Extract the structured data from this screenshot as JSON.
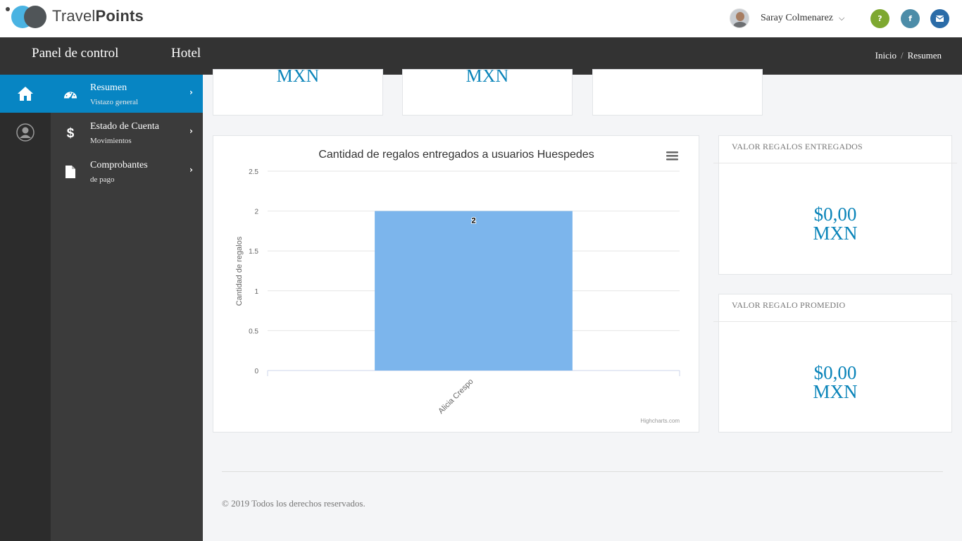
{
  "brand": {
    "light": "Travel",
    "bold": "Points"
  },
  "user": {
    "name": "Saray Colmenarez"
  },
  "topbar_buttons": {
    "help": "?",
    "facebook": "f",
    "mail": "✉"
  },
  "header": {
    "panel_label": "Panel de control",
    "section_label": "Hotel"
  },
  "breadcrumb": {
    "items": [
      "Inicio",
      "Resumen"
    ],
    "separator": "/"
  },
  "sidebar": {
    "items": [
      {
        "label": "Resumen",
        "sub": "Vistazo general",
        "active": true
      },
      {
        "label": "Estado de Cuenta",
        "sub": "Movimientos",
        "active": false
      },
      {
        "label": "Comprobantes",
        "sub": "de pago",
        "active": false
      }
    ]
  },
  "top_stats": [
    {
      "value": "MXN"
    },
    {
      "value": "MXN"
    },
    {
      "value": ""
    }
  ],
  "cards": {
    "valor_entregados": {
      "title": "VALOR REGALOS ENTREGADOS",
      "value_line1": "$0,00",
      "value_line2": "MXN"
    },
    "valor_promedio": {
      "title": "VALOR REGALO PROMEDIO",
      "value_line1": "$0,00",
      "value_line2": "MXN"
    }
  },
  "chart_data": {
    "type": "bar",
    "title": "Cantidad de regalos entregados a usuarios Huespedes",
    "ylabel": "Cantidad de regalos",
    "xlabel": "",
    "categories": [
      "Alicia Crespo"
    ],
    "values": [
      2
    ],
    "data_labels": [
      "2"
    ],
    "ylim": [
      0,
      2.5
    ],
    "yticks": [
      "0",
      "0.5",
      "1",
      "1.5",
      "2",
      "2.5"
    ],
    "grid": true,
    "bar_color": "#7cb5ec",
    "credit": "Highcharts.com"
  },
  "footer": {
    "text": "© 2019 Todos los derechos reservados."
  },
  "colors": {
    "accent": "#0785c3",
    "value": "#0a84b9",
    "dark_bar": "#333333"
  }
}
